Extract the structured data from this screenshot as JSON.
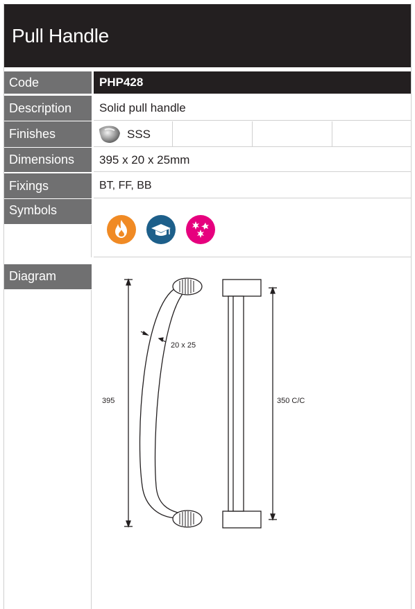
{
  "title": "Pull Handle",
  "rows": {
    "code": {
      "label": "Code",
      "value": "PHP428"
    },
    "description": {
      "label": "Description",
      "value": "Solid pull handle"
    },
    "finishes": {
      "label": "Finishes",
      "value": "SSS"
    },
    "dimensions": {
      "label": "Dimensions",
      "value": "395 x 20 x 25mm"
    },
    "fixings": {
      "label": "Fixings",
      "value": "BT, FF, BB"
    },
    "symbols": {
      "label": "Symbols"
    },
    "diagram": {
      "label": "Diagram"
    }
  },
  "symbols": [
    {
      "icon": "fire-rated-icon",
      "color": "#f08a24"
    },
    {
      "icon": "education-cap-icon",
      "color": "#1d5f8a"
    },
    {
      "icon": "antibacterial-icon",
      "color": "#e6007e"
    }
  ],
  "diagram": {
    "overall_length": "395",
    "section": "20 x 25",
    "centres": "350 C/C"
  }
}
